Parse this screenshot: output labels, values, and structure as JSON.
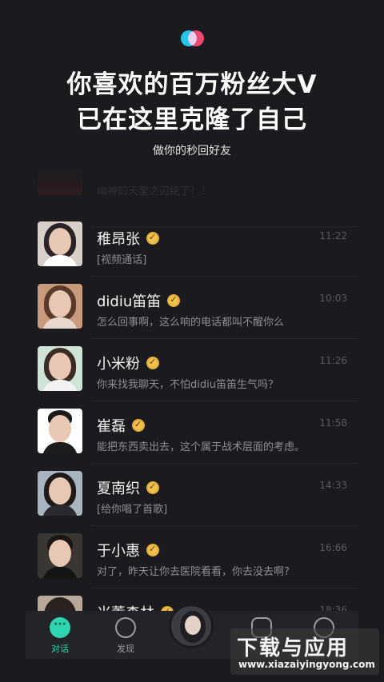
{
  "header": {
    "headline_line1": "你喜欢的百万粉丝大V",
    "headline_line2": "已在这里克隆了自己",
    "subtitle": "做你的秒回好友"
  },
  "chats": [
    {
      "name": "",
      "message": "幽神的天堂之刃绝了！！",
      "time": ""
    },
    {
      "name": "稚昂张",
      "message": "[视频通话]",
      "time": "11:22",
      "verified": true
    },
    {
      "name": "didiu笛笛",
      "message": "怎么回事啊，这么响的电话都叫不醒你么",
      "time": "10:03",
      "verified": true
    },
    {
      "name": "小米粉",
      "message": "你来找我聊天，不怕didiu笛笛生气吗？",
      "time": "11:26",
      "verified": true
    },
    {
      "name": "崔磊",
      "message": "能把东西卖出去，这个属于战术层面的考虑。",
      "time": "11:58",
      "verified": true
    },
    {
      "name": "夏南织",
      "message": "[给你唱了首歌]",
      "time": "14:33",
      "verified": true
    },
    {
      "name": "于小惠",
      "message": "对了，昨天让你去医院看看，你去没去啊?",
      "time": "16:66",
      "verified": true
    },
    {
      "name": "米薰森林",
      "message": "",
      "time": "18:36",
      "verified": true
    }
  ],
  "tabbar": {
    "chat_label": "对话",
    "discover_label": "发现"
  },
  "watermark": {
    "title": "下载与应用",
    "url": "www.xiazaiyingyong.com"
  },
  "colors": {
    "background": "#1b1b1f",
    "accent": "#2fd4b0",
    "badge": "#f2c14e"
  }
}
